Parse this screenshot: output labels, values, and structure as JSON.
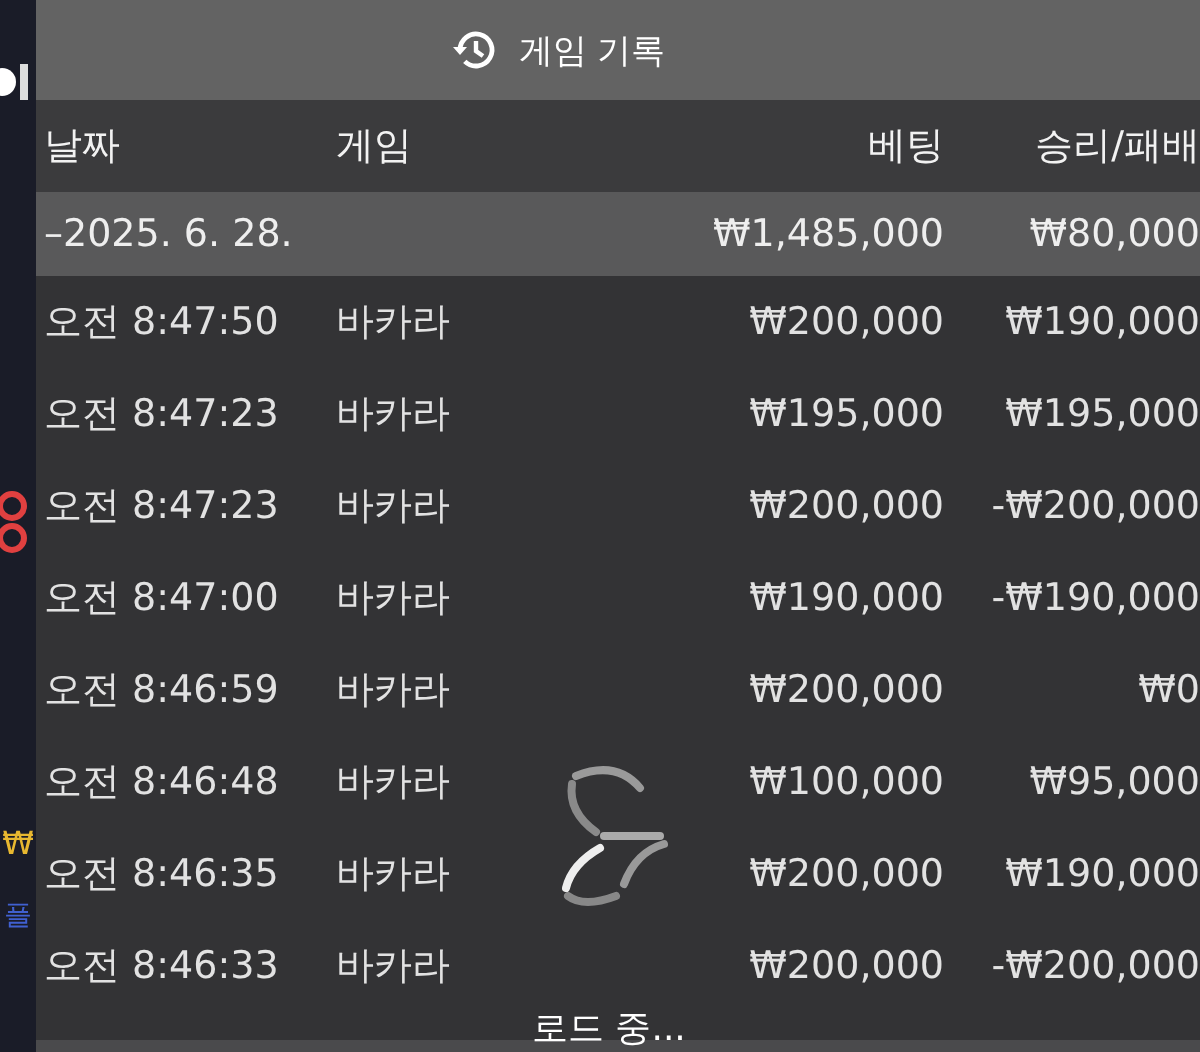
{
  "background": {
    "currency_mark": "₩",
    "side_label": "플"
  },
  "dialog": {
    "title": "게임 기록"
  },
  "columns": [
    "날짜",
    "게임",
    "베팅",
    "승리/패배"
  ],
  "summary": {
    "date": "–2025. 6. 28.",
    "bet": "₩1,485,000",
    "result": "₩80,000"
  },
  "rows": [
    {
      "time": "오전 8:47:50",
      "game": "바카라",
      "bet": "₩200,000",
      "result": "₩190,000"
    },
    {
      "time": "오전 8:47:23",
      "game": "바카라",
      "bet": "₩195,000",
      "result": "₩195,000"
    },
    {
      "time": "오전 8:47:23",
      "game": "바카라",
      "bet": "₩200,000",
      "result": "-₩200,000"
    },
    {
      "time": "오전 8:47:00",
      "game": "바카라",
      "bet": "₩190,000",
      "result": "-₩190,000"
    },
    {
      "time": "오전 8:46:59",
      "game": "바카라",
      "bet": "₩200,000",
      "result": "₩0"
    },
    {
      "time": "오전 8:46:48",
      "game": "바카라",
      "bet": "₩100,000",
      "result": "₩95,000"
    },
    {
      "time": "오전 8:46:35",
      "game": "바카라",
      "bet": "₩200,000",
      "result": "₩190,000"
    },
    {
      "time": "오전 8:46:33",
      "game": "바카라",
      "bet": "₩200,000",
      "result": "-₩200,000"
    }
  ],
  "loading": {
    "text": "로드 중..."
  }
}
